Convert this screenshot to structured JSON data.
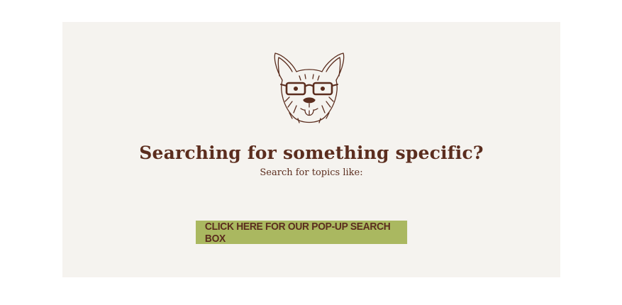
{
  "search_promo": {
    "illustration": "corgi-with-glasses",
    "headline": "Searching for something specific?",
    "subheadline": "Search for topics like:",
    "cta_label": "CLICK HERE FOR OUR POP-UP SEARCH BOX"
  },
  "colors": {
    "panel_bg": "#f5f3ef",
    "text_brown": "#5b2d1e",
    "button_green": "#aab860"
  }
}
